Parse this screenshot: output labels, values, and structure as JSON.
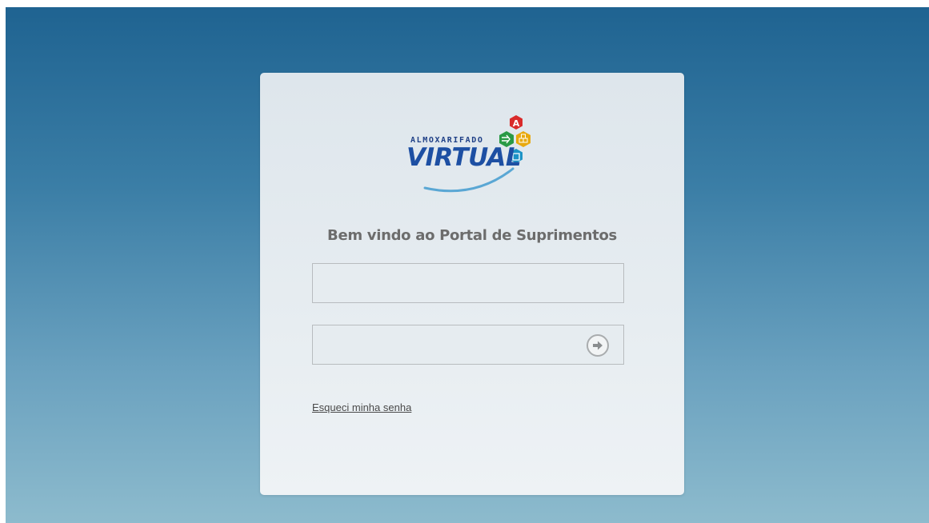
{
  "logo": {
    "small_text": "ALMOXARIFADO",
    "big_text": "VIRTUAL",
    "colors": {
      "navy": "#1e3f86",
      "blue": "#1d4fa3",
      "red": "#d92b2b",
      "green": "#2a9a46",
      "yellow": "#e8a90f",
      "cyan": "#1c93c6"
    }
  },
  "login": {
    "welcome_title": "Bem vindo ao Portal de Suprimentos",
    "username": {
      "value": "",
      "placeholder": ""
    },
    "password": {
      "value": "",
      "placeholder": ""
    },
    "submit_icon": "arrow-right-circle-icon",
    "forgot_password_label": "Esqueci minha senha"
  },
  "colors": {
    "background_top": "#1f6391",
    "background_bottom": "#8dbbcd",
    "card": "#e6ecf0",
    "title_text": "#6c6c6c"
  }
}
